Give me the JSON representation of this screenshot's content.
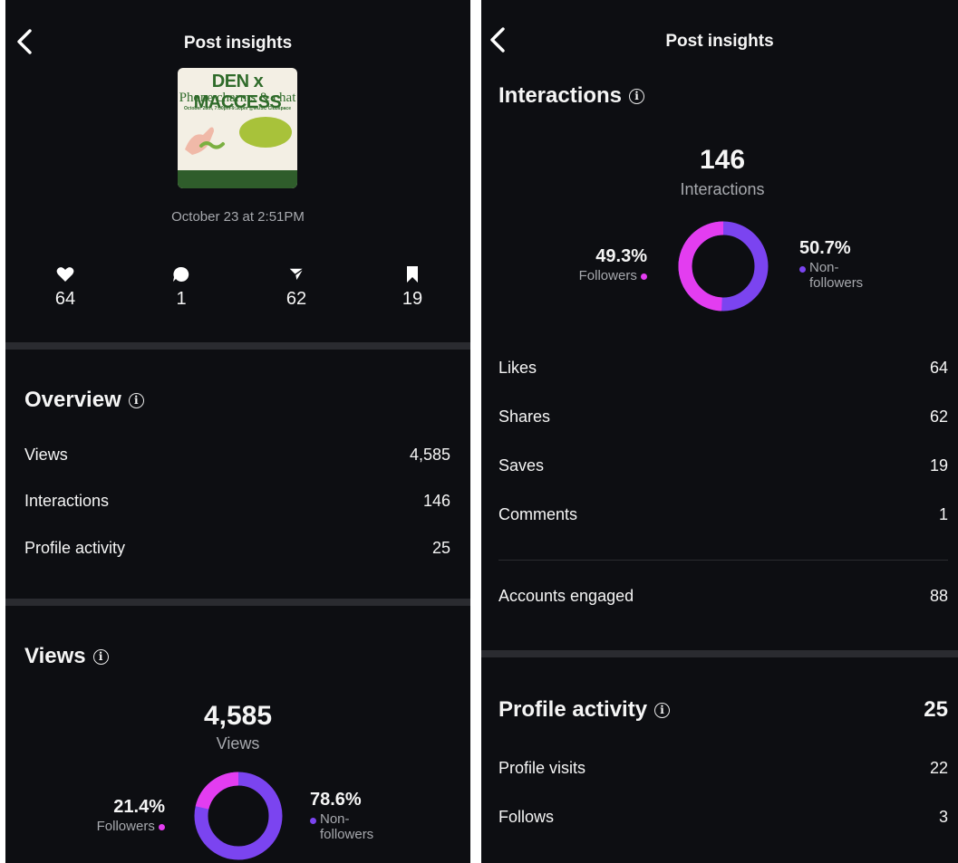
{
  "colors": {
    "followers": "#e33df0",
    "nonfollowers": "#7b44f0"
  },
  "left": {
    "header": {
      "title": "Post insights"
    },
    "post": {
      "thumb_line1": "DEN x MACCESS",
      "thumb_line2": "Phone charms & chat",
      "thumb_line3": "October 28th, 7:00pm-9:30pm @MUSC Clubspace",
      "date": "October 23 at 2:51PM"
    },
    "stats": {
      "likes": "64",
      "comments": "1",
      "shares": "62",
      "saves": "19"
    },
    "overview": {
      "title": "Overview",
      "rows": [
        {
          "label": "Views",
          "value": "4,585"
        },
        {
          "label": "Interactions",
          "value": "146"
        },
        {
          "label": "Profile activity",
          "value": "25"
        }
      ]
    },
    "views": {
      "title": "Views",
      "total": "4,585",
      "total_label": "Views",
      "followers_pct": "21.4%",
      "followers_label": "Followers",
      "non_pct": "78.6%",
      "non_label": "Non-followers",
      "followers_fraction": 0.214
    }
  },
  "right": {
    "header": {
      "title": "Post insights"
    },
    "interactions": {
      "title": "Interactions",
      "total": "146",
      "total_label": "Interactions",
      "followers_pct": "49.3%",
      "followers_label": "Followers",
      "non_pct": "50.7%",
      "non_label": "Non-followers",
      "followers_fraction": 0.493,
      "rows": [
        {
          "label": "Likes",
          "value": "64"
        },
        {
          "label": "Shares",
          "value": "62"
        },
        {
          "label": "Saves",
          "value": "19"
        },
        {
          "label": "Comments",
          "value": "1"
        }
      ],
      "accounts_label": "Accounts engaged",
      "accounts_value": "88"
    },
    "profile_activity": {
      "title": "Profile activity",
      "total": "25",
      "rows": [
        {
          "label": "Profile visits",
          "value": "22"
        },
        {
          "label": "Follows",
          "value": "3"
        }
      ]
    }
  }
}
